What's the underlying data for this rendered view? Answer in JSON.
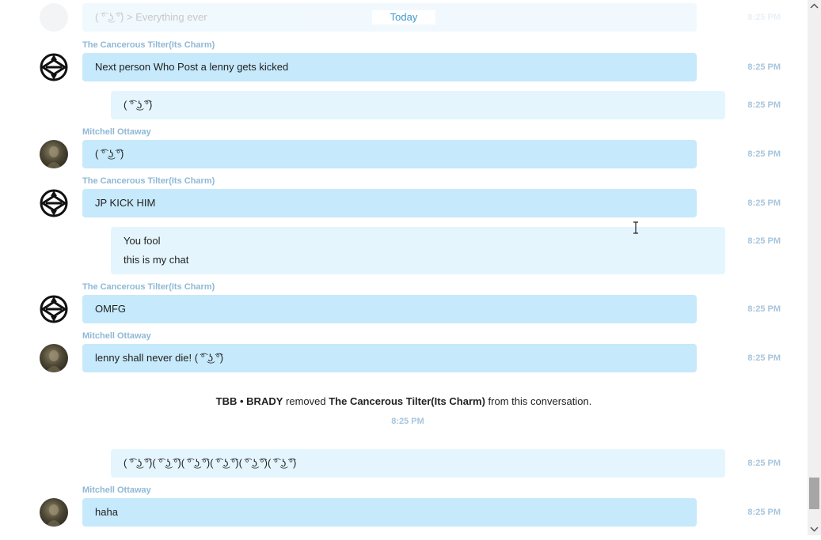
{
  "separator": {
    "today_label": "Today"
  },
  "messages": [
    {
      "sender": "The Cancerous Tilter(Its Charm)",
      "text": "Next person Who Post a lenny gets kicked",
      "time": "8:25 PM"
    },
    {
      "text": "( ͡° ͜ʖ ͡°)",
      "time": "8:25 PM"
    },
    {
      "sender": "Mitchell Ottaway",
      "text": "( ͡° ͜ʖ ͡°)",
      "time": "8:25 PM"
    },
    {
      "sender": "The Cancerous Tilter(Its Charm)",
      "text": "JP KICK HIM",
      "time": "8:25 PM"
    },
    {
      "line1": "You fool",
      "line2": "this is my chat",
      "time": "8:25 PM"
    },
    {
      "sender": "The Cancerous Tilter(Its Charm)",
      "text": "OMFG",
      "time": "8:25 PM"
    },
    {
      "sender": "Mitchell Ottaway",
      "text": "lenny shall never die! ( ͡° ͜ʖ ͡°)",
      "time": "8:25 PM"
    },
    {
      "text": "( ͡° ͜ʖ ͡°)( ͡° ͜ʖ ͡°)( ͡° ͜ʖ ͡°)( ͡° ͜ʖ ͡°)( ͡° ͜ʖ ͡°)( ͡° ͜ʖ ͡°)",
      "time": "8:25 PM"
    },
    {
      "sender": "Mitchell Ottaway",
      "text": "haha",
      "time": "8:25 PM"
    }
  ],
  "faded_top": {
    "text": "( ͡° ͜ʖ ͡°) > Everything ever",
    "time": "8:25 PM"
  },
  "system_event": {
    "actor": "TBB • BRADY",
    "action": "removed",
    "target": "The Cancerous Tilter(Its Charm)",
    "suffix": "from this conversation.",
    "time": "8:25 PM"
  },
  "icons": {
    "tilter_avatar": "emblem-avatar-icon",
    "mitchell_avatar": "photo-avatar-icon",
    "scroll_up": "chevron-up-icon",
    "scroll_down": "chevron-down-icon",
    "cursor": "text-cursor-icon"
  },
  "colors": {
    "incoming_bubble": "#c6e9fb",
    "outgoing_bubble": "#e4f5fd",
    "sender_name": "#8fb8d6",
    "timestamp": "#a7c5dc",
    "today_label": "#3d9ad1"
  }
}
